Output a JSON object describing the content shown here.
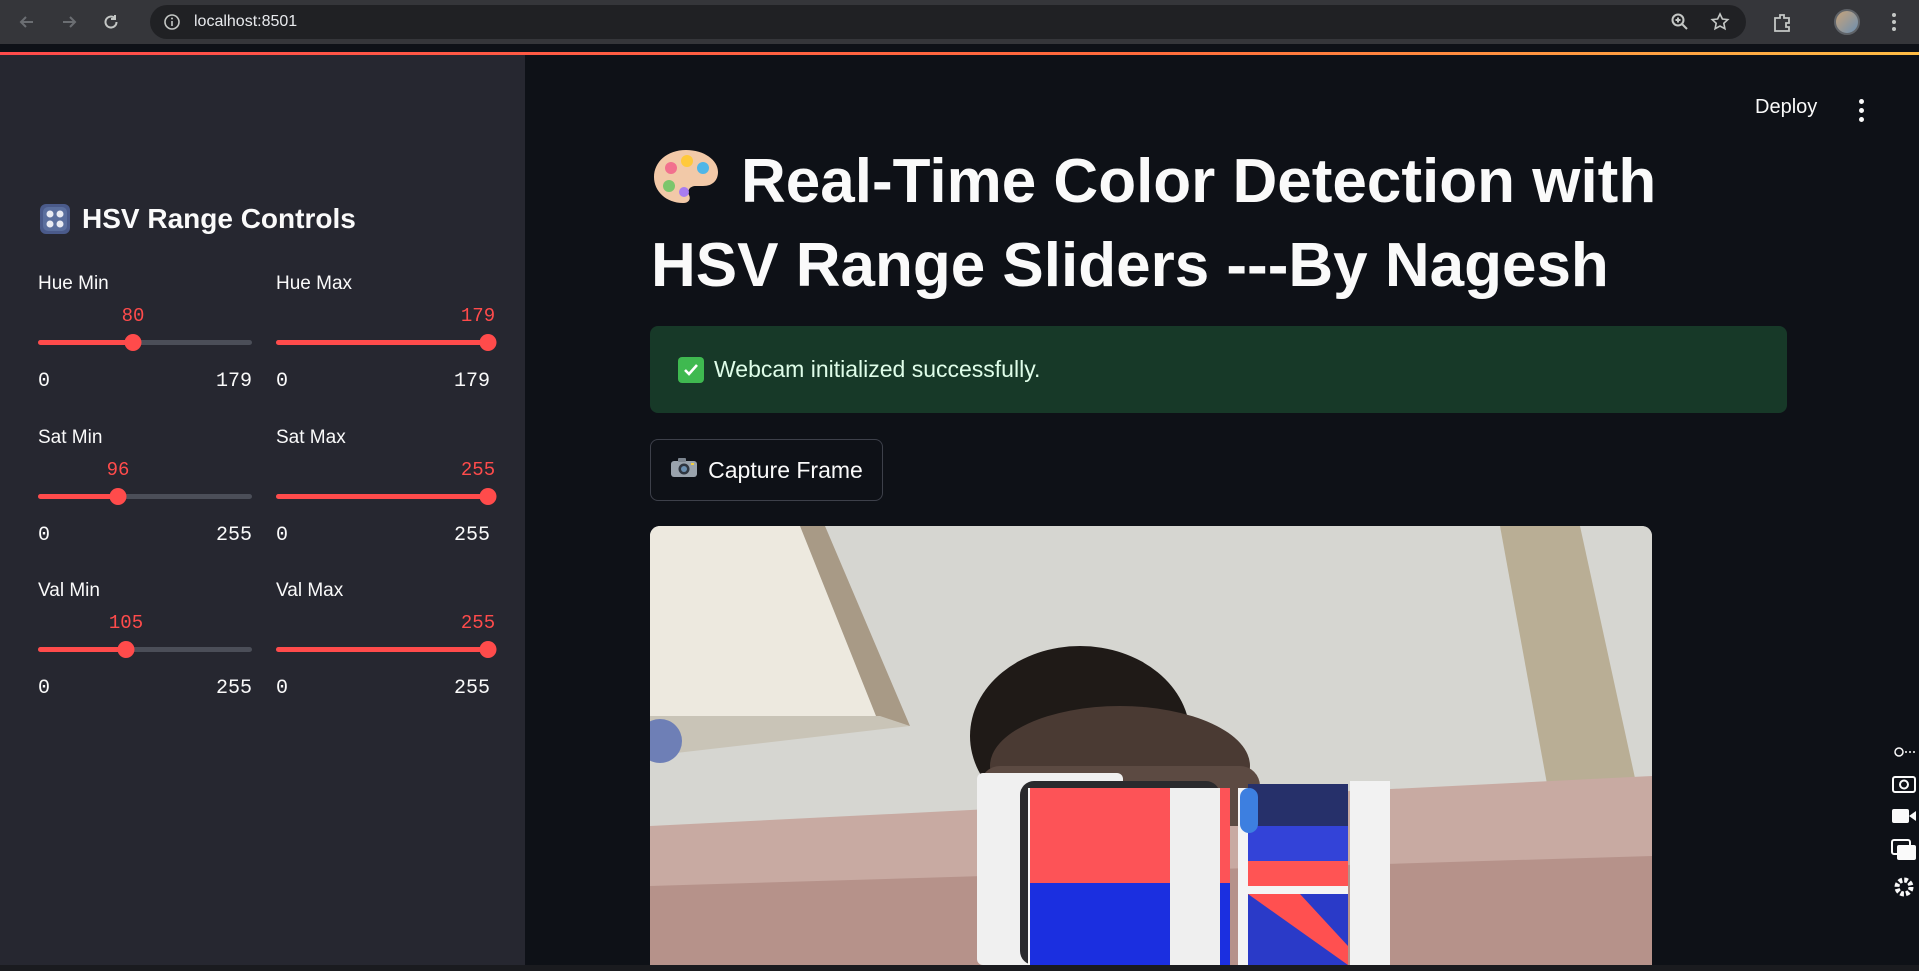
{
  "browser": {
    "url": "localhost:8501"
  },
  "sidebar": {
    "title": "HSV Range Controls",
    "sliders": [
      {
        "label": "Hue Min",
        "value": "80",
        "min": "0",
        "max": "179",
        "fraction": 0.447
      },
      {
        "label": "Hue Max",
        "value": "179",
        "min": "0",
        "max": "179",
        "fraction": 1.0
      },
      {
        "label": "Sat Min",
        "value": "96",
        "min": "0",
        "max": "255",
        "fraction": 0.376
      },
      {
        "label": "Sat Max",
        "value": "255",
        "min": "0",
        "max": "255",
        "fraction": 1.0
      },
      {
        "label": "Val Min",
        "value": "105",
        "min": "0",
        "max": "255",
        "fraction": 0.412
      },
      {
        "label": "Val Max",
        "value": "255",
        "min": "0",
        "max": "255",
        "fraction": 1.0
      }
    ]
  },
  "header": {
    "deploy_label": "Deploy"
  },
  "main": {
    "title": "Real-Time Color Detection with HSV Range Sliders ---By Nagesh",
    "success_message": "Webcam initialized successfully.",
    "capture_button_label": "Capture Frame"
  },
  "colors": {
    "accent": "#ff4b4b",
    "background": "#0e1117",
    "sidebar": "#262730",
    "success_bg": "#173928"
  }
}
